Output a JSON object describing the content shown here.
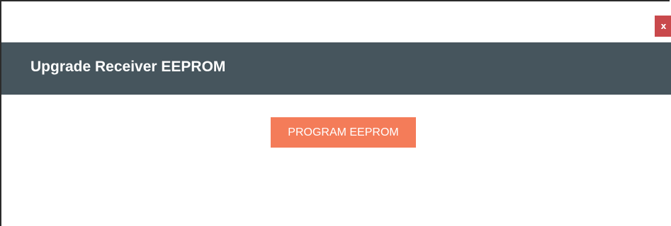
{
  "window": {
    "close_label": "x"
  },
  "header": {
    "title": "Upgrade Receiver EEPROM"
  },
  "actions": {
    "program_label": "PROGRAM EEPROM"
  },
  "colors": {
    "header_bg": "#46555d",
    "close_bg": "#c9494c",
    "button_bg": "#f47c59",
    "text_on_dark": "#ffffff"
  }
}
